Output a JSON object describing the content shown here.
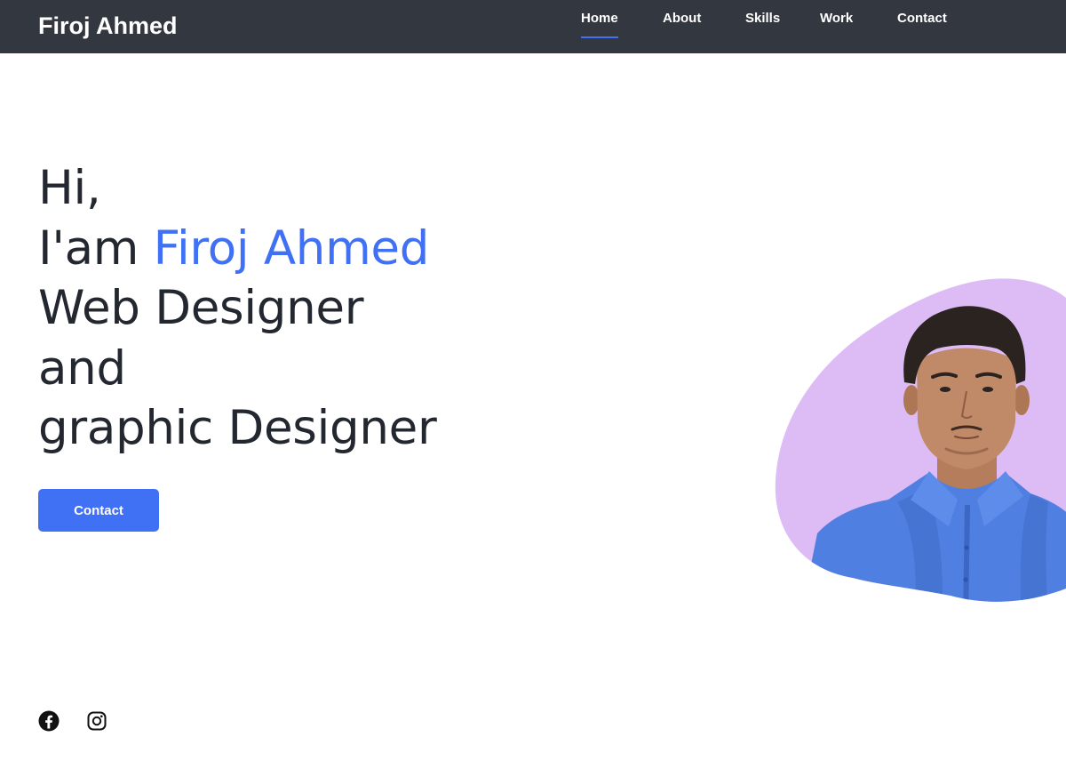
{
  "header": {
    "logo": "Firoj Ahmed",
    "nav": [
      {
        "label": "Home",
        "active": true
      },
      {
        "label": "About",
        "active": false
      },
      {
        "label": "Skills",
        "active": false
      },
      {
        "label": "Work",
        "active": false
      },
      {
        "label": "Contact",
        "active": false
      }
    ]
  },
  "hero": {
    "line1": "Hi,",
    "line2_prefix": "I'am ",
    "line2_name": "Firoj Ahmed",
    "line3": "Web Designer",
    "line4": "and",
    "line5": "graphic Designer",
    "button_label": "Contact"
  },
  "social": {
    "items": [
      {
        "icon": "facebook-icon"
      },
      {
        "icon": "instagram-icon"
      }
    ]
  },
  "colors": {
    "header_bg": "#33373f",
    "accent": "#4070f4",
    "blob": "#ddbcf6",
    "text": "#23272f"
  }
}
